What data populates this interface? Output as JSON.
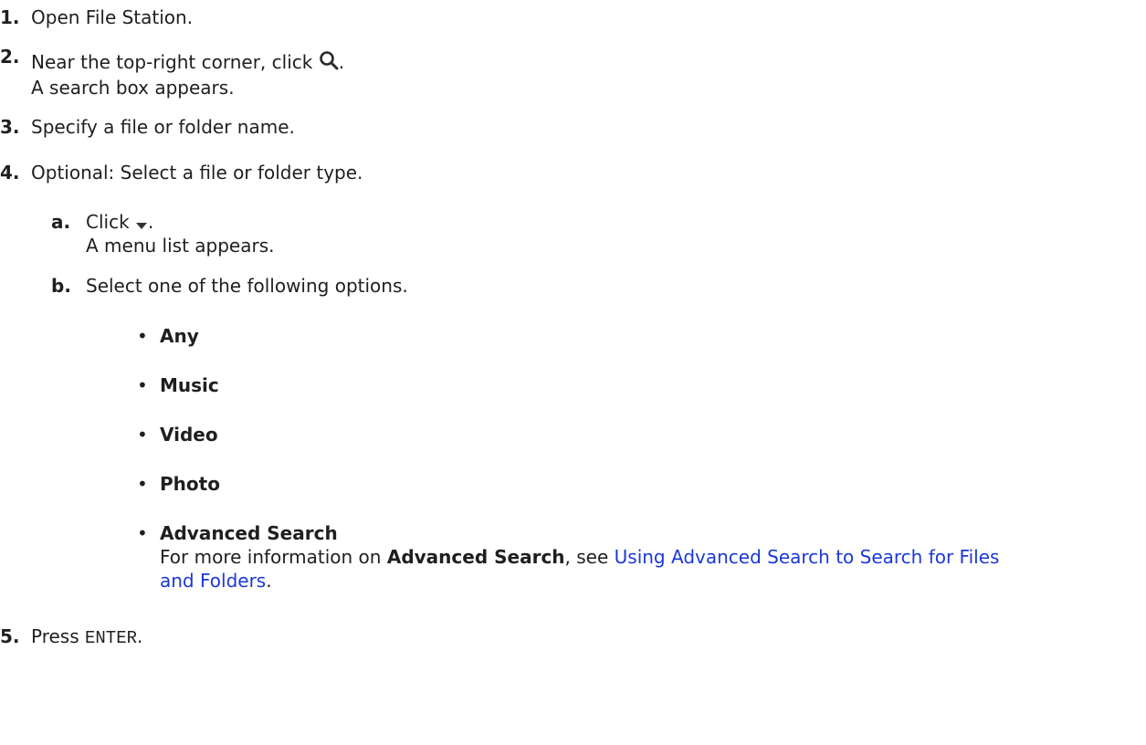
{
  "steps": [
    {
      "num": "1.",
      "text": "Open File Station."
    },
    {
      "num": "2.",
      "text_before": "Near the top-right corner, click",
      "text_after": ".",
      "result": "A search box appears.",
      "icon": "search-icon"
    },
    {
      "num": "3.",
      "text": "Specify a file or folder name."
    },
    {
      "num": "4.",
      "text": "Optional: Select a file or folder type.",
      "substeps": [
        {
          "label": "a.",
          "text_before": "Click",
          "text_after": ".",
          "result": "A menu list appears.",
          "icon": "dropdown-arrow-icon"
        },
        {
          "label": "b.",
          "text": "Select one of the following options."
        }
      ],
      "options": [
        "Any",
        "Music",
        "Video",
        "Photo",
        "Advanced Search"
      ],
      "advanced_note": {
        "prefix": "For more information on",
        "bold": "Advanced Search",
        "middle": ", see",
        "link_line1": "Using Advanced Search to Search for Files",
        "link_line2": "and Folders",
        "suffix": "."
      }
    },
    {
      "num": "5.",
      "text_before": "Press",
      "code": "ENTER",
      "text_after": "."
    }
  ],
  "colors": {
    "link": "#1a38d8",
    "text": "#1f1f1f"
  }
}
